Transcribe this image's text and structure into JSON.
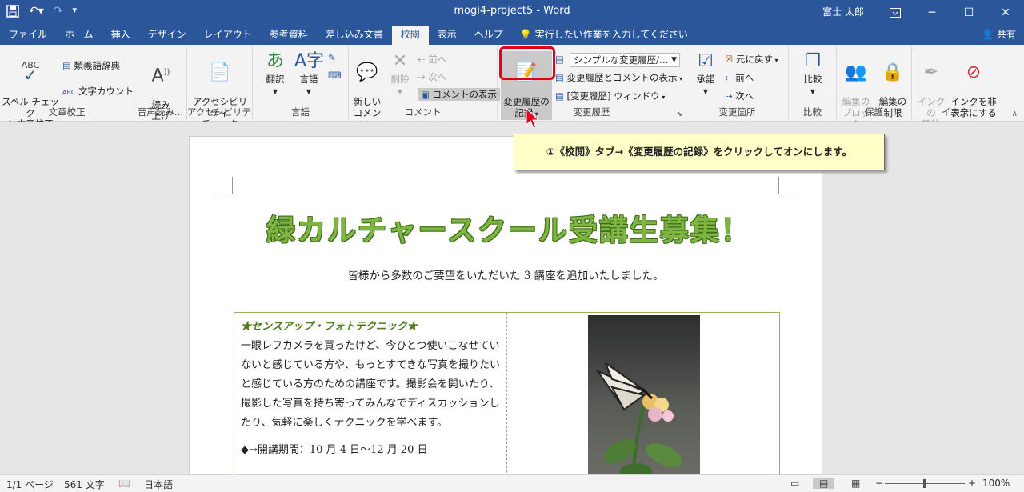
{
  "title_bar": {
    "doc_title": "mogi4-project5 - Word",
    "user": "富士 太郎",
    "qat": {
      "save_icon": "save-icon",
      "undo_icon": "undo-icon",
      "redo_icon": "redo-icon",
      "customize_icon": "customize-qat-icon"
    },
    "window_controls": {
      "ribbon_opts": "ribbon-display-options-icon",
      "minimize": "─",
      "maximize": "☐",
      "close": "✕"
    }
  },
  "tabs": [
    {
      "label": "ファイル"
    },
    {
      "label": "ホーム"
    },
    {
      "label": "挿入"
    },
    {
      "label": "デザイン"
    },
    {
      "label": "レイアウト"
    },
    {
      "label": "参考資料"
    },
    {
      "label": "差し込み文書"
    },
    {
      "label": "校閲"
    },
    {
      "label": "表示"
    },
    {
      "label": "ヘルプ"
    }
  ],
  "tell_me": "実行したい作業を入力してください",
  "share": "共有",
  "ribbon": {
    "proofing": {
      "label": "文章校正",
      "spelling": "スペル チェック\nと文章校正",
      "thesaurus": "類義語辞典",
      "wordcount": "文字カウント"
    },
    "speech": {
      "label": "音声読み…",
      "read_aloud": "読み\n上げ"
    },
    "accessibility": {
      "label": "アクセシビリティ",
      "check": "アクセシビリティ\nチェック"
    },
    "language": {
      "label": "言語",
      "translate": "翻訳",
      "language": "言語"
    },
    "comments": {
      "label": "コメント",
      "new": "新しい\nコメント",
      "delete": "削除",
      "prev": "前へ",
      "next": "次へ",
      "show": "コメントの表示"
    },
    "tracking": {
      "label": "変更履歴",
      "track": "変更履歴の\n記録",
      "markup_dropdown": "シンプルな変更履歴/…",
      "show_markup": "変更履歴とコメントの表示",
      "pane": "[変更履歴] ウィンドウ"
    },
    "changes": {
      "label": "変更箇所",
      "accept": "承諾",
      "reject": "元に戻す",
      "prev": "前へ",
      "next": "次へ"
    },
    "compare": {
      "label": "比較",
      "compare": "比較"
    },
    "protect": {
      "label": "保護",
      "block": "編集の\nブロック",
      "restrict": "編集の\n制限"
    },
    "ink": {
      "label": "インク",
      "start": "インクの\n開始",
      "hide": "インクを非\n表示にする"
    }
  },
  "callout": "①《校閲》タブ→《変更履歴の記録》をクリックしてオンにします。",
  "document": {
    "heading": "緑カルチャースクール受講生募集！",
    "subtitle": "皆様から多数のご要望をいただいた 3 講座を追加いたしました。",
    "course_title": "★センスアップ・フォトテクニック★",
    "course_body": "一眼レフカメラを買ったけど、今ひとつ使いこなせていないと感じている方や、もっとすてきな写真を撮りたいと感じている方のための講座です。撮影会を開いたり、撮影した写真を持ち寄ってみんなでディスカッションしたり、気軽に楽しくテクニックを学べます。",
    "period": "◆→開講期間：10 月 4 日〜12 月 20 日"
  },
  "status_bar": {
    "page": "1/1 ページ",
    "words": "561 文字",
    "language": "日本語",
    "zoom": "100%"
  }
}
